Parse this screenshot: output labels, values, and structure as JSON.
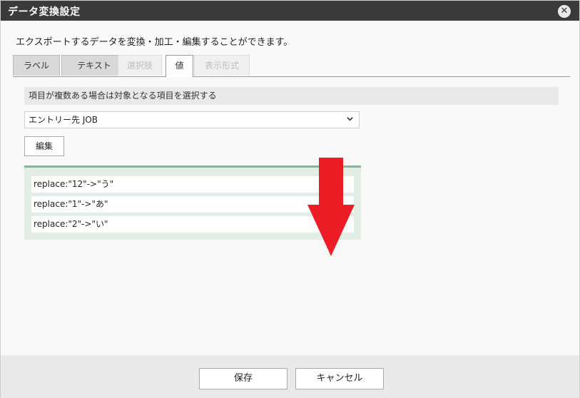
{
  "dialog": {
    "title": "データ変換設定",
    "close_icon": "close-icon",
    "description": "エクスポートするデータを変換・加工・編集することができます。"
  },
  "tabs": [
    {
      "label": "ラベル",
      "state": "inactive"
    },
    {
      "label": "テキスト",
      "state": "inactive"
    },
    {
      "label": "選択肢",
      "state": "disabled"
    },
    {
      "label": "値",
      "state": "active"
    },
    {
      "label": "表示形式",
      "state": "disabled"
    }
  ],
  "panel": {
    "header": "項目が複数ある場合は対象となる項目を選択する",
    "select_value": "エントリー先 JOB",
    "edit_label": "編集",
    "values": [
      "replace:\"12\"->\"う\"",
      "replace:\"1\"->\"あ\"",
      "replace:\"2\"->\"い\""
    ]
  },
  "annotation": {
    "arrow_color": "#ee1c25",
    "arrow_direction": "down"
  },
  "footer": {
    "save_label": "保存",
    "cancel_label": "キャンセル"
  }
}
